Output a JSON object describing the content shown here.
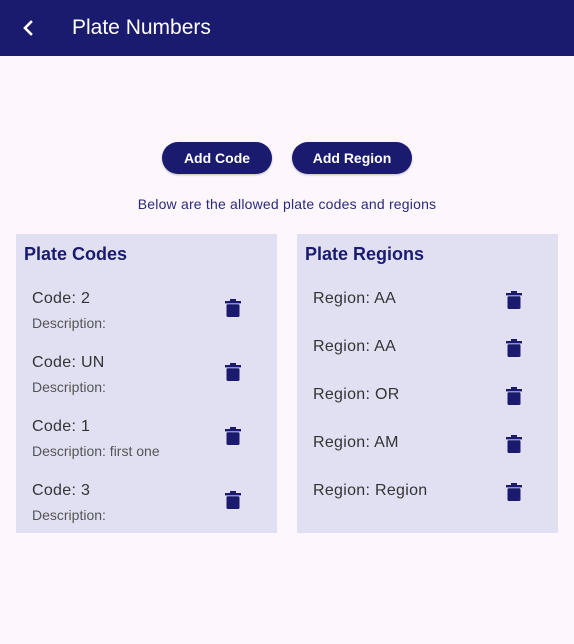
{
  "appbar": {
    "title": "Plate Numbers",
    "back_icon": "arrow-back-icon"
  },
  "actions": {
    "add_code_label": "Add Code",
    "add_region_label": "Add Region"
  },
  "subtitle": "Below are the allowed plate codes and regions",
  "codes_panel": {
    "title": "Plate Codes",
    "items": [
      {
        "code": "Code: 2",
        "description": "Description:"
      },
      {
        "code": "Code: UN",
        "description": "Description:"
      },
      {
        "code": "Code: 1",
        "description": "Description: first one"
      },
      {
        "code": "Code: 3",
        "description": "Description:"
      }
    ]
  },
  "regions_panel": {
    "title": "Plate Regions",
    "items": [
      {
        "region": "Region: AA"
      },
      {
        "region": "Region: AA"
      },
      {
        "region": "Region: OR"
      },
      {
        "region": "Region: AM"
      },
      {
        "region": "Region: Region"
      }
    ]
  },
  "colors": {
    "primary": "#1a1a6e",
    "panel_background": "#e1e0f2",
    "page_background": "#fdf7fd"
  },
  "icons": {
    "delete": "trash-icon"
  }
}
